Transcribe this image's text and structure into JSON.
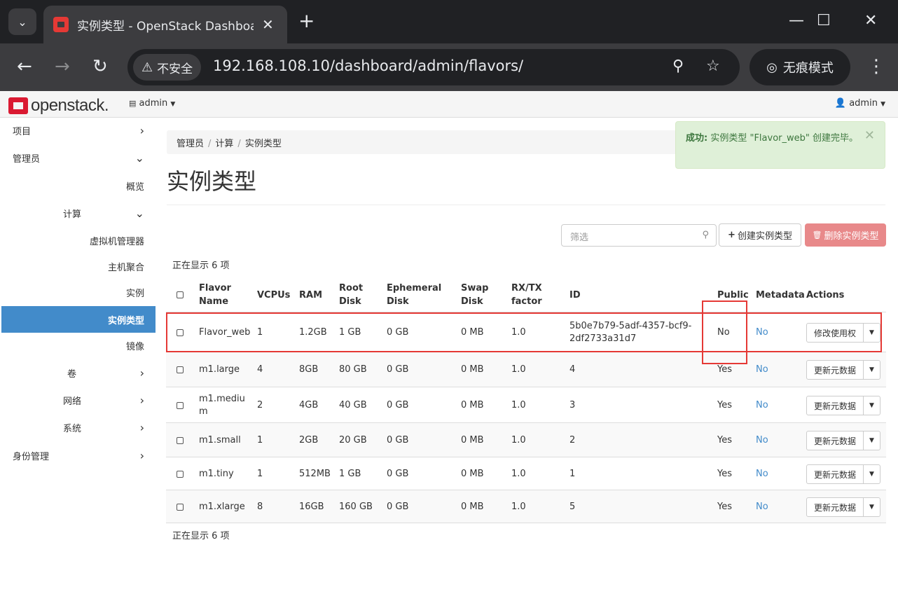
{
  "browser": {
    "tab_title": "实例类型 - OpenStack Dashboard",
    "security_label": "不安全",
    "url": "192.168.108.10/dashboard/admin/flavors/",
    "incognito_label": "无痕模式"
  },
  "header": {
    "logo_text": "openstack.",
    "project": "admin",
    "user": "admin"
  },
  "sidebar": {
    "items": [
      {
        "label": "项目"
      },
      {
        "label": "管理员"
      },
      {
        "label": "概览"
      },
      {
        "label": "计算"
      },
      {
        "label": "虚拟机管理器"
      },
      {
        "label": "主机聚合"
      },
      {
        "label": "实例"
      },
      {
        "label": "实例类型"
      },
      {
        "label": "镜像"
      },
      {
        "label": "卷"
      },
      {
        "label": "网络"
      },
      {
        "label": "系统"
      },
      {
        "label": "身份管理"
      }
    ]
  },
  "breadcrumb": [
    "管理员",
    "计算",
    "实例类型"
  ],
  "page_title": "实例类型",
  "alert": {
    "prefix": "成功:",
    "message": "实例类型 \"Flavor_web\" 创建完毕。"
  },
  "toolbar": {
    "filter_placeholder": "筛选",
    "create_label": "创建实例类型",
    "delete_label": "删除实例类型"
  },
  "count_text": "正在显示 6 项",
  "table": {
    "headers": {
      "name": [
        "Flavor",
        "Name"
      ],
      "vcpus": "VCPUs",
      "ram": "RAM",
      "root": [
        "Root",
        "Disk"
      ],
      "ephemeral": [
        "Ephemeral",
        "Disk"
      ],
      "swap": [
        "Swap",
        "Disk"
      ],
      "rxtx": [
        "RX/TX",
        "factor"
      ],
      "id": "ID",
      "public": "Public",
      "metadata": "Metadata",
      "actions": "Actions"
    },
    "rows": [
      {
        "name": "Flavor_web",
        "vcpus": "1",
        "ram": "1.2GB",
        "root": "1 GB",
        "ephemeral": "0 GB",
        "swap": "0 MB",
        "rxtx": "1.0",
        "id": [
          "5b0e7b79-5adf-4357-bcf9-",
          "2df2733a31d7"
        ],
        "public": "No",
        "metadata": "No",
        "action": "修改使用权"
      },
      {
        "name": "m1.large",
        "vcpus": "4",
        "ram": "8GB",
        "root": "80 GB",
        "ephemeral": "0 GB",
        "swap": "0 MB",
        "rxtx": "1.0",
        "id": [
          "4"
        ],
        "public": "Yes",
        "metadata": "No",
        "action": "更新元数据"
      },
      {
        "name": "m1.mediu\nm",
        "vcpus": "2",
        "ram": "4GB",
        "root": "40 GB",
        "ephemeral": "0 GB",
        "swap": "0 MB",
        "rxtx": "1.0",
        "id": [
          "3"
        ],
        "public": "Yes",
        "metadata": "No",
        "action": "更新元数据"
      },
      {
        "name": "m1.small",
        "vcpus": "1",
        "ram": "2GB",
        "root": "20 GB",
        "ephemeral": "0 GB",
        "swap": "0 MB",
        "rxtx": "1.0",
        "id": [
          "2"
        ],
        "public": "Yes",
        "metadata": "No",
        "action": "更新元数据"
      },
      {
        "name": "m1.tiny",
        "vcpus": "1",
        "ram": "512MB",
        "root": "1 GB",
        "ephemeral": "0 GB",
        "swap": "0 MB",
        "rxtx": "1.0",
        "id": [
          "1"
        ],
        "public": "Yes",
        "metadata": "No",
        "action": "更新元数据"
      },
      {
        "name": "m1.xlarge",
        "vcpus": "8",
        "ram": "16GB",
        "root": "160 GB",
        "ephemeral": "0 GB",
        "swap": "0 MB",
        "rxtx": "1.0",
        "id": [
          "5"
        ],
        "public": "Yes",
        "metadata": "No",
        "action": "更新元数据"
      }
    ]
  },
  "colors": {
    "accent": "#428bca",
    "highlight": "#e53935",
    "success_bg": "#dff0d8",
    "danger_btn": "#e8898a"
  }
}
